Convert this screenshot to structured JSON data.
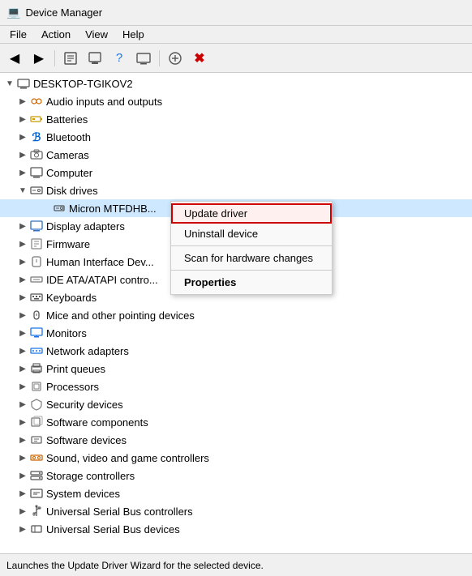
{
  "titleBar": {
    "title": "Device Manager",
    "icon": "💻"
  },
  "menuBar": {
    "items": [
      {
        "id": "file",
        "label": "File"
      },
      {
        "id": "action",
        "label": "Action"
      },
      {
        "id": "view",
        "label": "View"
      },
      {
        "id": "help",
        "label": "Help"
      }
    ]
  },
  "toolbar": {
    "buttons": [
      {
        "id": "back",
        "icon": "◀",
        "label": "Back"
      },
      {
        "id": "forward",
        "icon": "▶",
        "label": "Forward"
      },
      {
        "id": "show-props",
        "icon": "⊟",
        "label": "Properties"
      },
      {
        "id": "update",
        "icon": "📄",
        "label": "Update Driver"
      },
      {
        "id": "uninstall",
        "icon": "❓",
        "label": "Uninstall"
      },
      {
        "id": "scan",
        "icon": "🖥",
        "label": "Scan"
      },
      {
        "id": "add",
        "icon": "➕",
        "label": "Add"
      },
      {
        "id": "remove",
        "icon": "✖",
        "label": "Remove"
      }
    ]
  },
  "tree": {
    "root": "DESKTOP-TGIKOV2",
    "items": [
      {
        "id": "root",
        "label": "DESKTOP-TGIKOV2",
        "indent": 0,
        "expanded": true,
        "icon": "computer",
        "hasExpander": true
      },
      {
        "id": "audio",
        "label": "Audio inputs and outputs",
        "indent": 1,
        "expanded": false,
        "icon": "sound",
        "hasExpander": true
      },
      {
        "id": "batteries",
        "label": "Batteries",
        "indent": 1,
        "expanded": false,
        "icon": "battery",
        "hasExpander": true
      },
      {
        "id": "bluetooth",
        "label": "Bluetooth",
        "indent": 1,
        "expanded": false,
        "icon": "bluetooth",
        "hasExpander": true
      },
      {
        "id": "cameras",
        "label": "Cameras",
        "indent": 1,
        "expanded": false,
        "icon": "camera",
        "hasExpander": true
      },
      {
        "id": "computer",
        "label": "Computer",
        "indent": 1,
        "expanded": false,
        "icon": "computer2",
        "hasExpander": true
      },
      {
        "id": "disk-drives",
        "label": "Disk drives",
        "indent": 1,
        "expanded": true,
        "icon": "disk",
        "hasExpander": true
      },
      {
        "id": "micron",
        "label": "Micron MTFDHB...",
        "indent": 2,
        "expanded": false,
        "icon": "harddisk",
        "hasExpander": false,
        "selected": true
      },
      {
        "id": "display",
        "label": "Display adapters",
        "indent": 1,
        "expanded": false,
        "icon": "adapter",
        "hasExpander": true
      },
      {
        "id": "firmware",
        "label": "Firmware",
        "indent": 1,
        "expanded": false,
        "icon": "firmware",
        "hasExpander": true
      },
      {
        "id": "hid",
        "label": "Human Interface Dev...",
        "indent": 1,
        "expanded": false,
        "icon": "hid",
        "hasExpander": true
      },
      {
        "id": "ide",
        "label": "IDE ATA/ATAPI contro...",
        "indent": 1,
        "expanded": false,
        "icon": "ide",
        "hasExpander": true
      },
      {
        "id": "keyboards",
        "label": "Keyboards",
        "indent": 1,
        "expanded": false,
        "icon": "keyboard",
        "hasExpander": true
      },
      {
        "id": "mice",
        "label": "Mice and other pointing devices",
        "indent": 1,
        "expanded": false,
        "icon": "mouse",
        "hasExpander": true
      },
      {
        "id": "monitors",
        "label": "Monitors",
        "indent": 1,
        "expanded": false,
        "icon": "monitor",
        "hasExpander": true
      },
      {
        "id": "network",
        "label": "Network adapters",
        "indent": 1,
        "expanded": false,
        "icon": "network",
        "hasExpander": true
      },
      {
        "id": "print",
        "label": "Print queues",
        "indent": 1,
        "expanded": false,
        "icon": "print",
        "hasExpander": true
      },
      {
        "id": "proc",
        "label": "Processors",
        "indent": 1,
        "expanded": false,
        "icon": "proc",
        "hasExpander": true
      },
      {
        "id": "security",
        "label": "Security devices",
        "indent": 1,
        "expanded": false,
        "icon": "security",
        "hasExpander": true
      },
      {
        "id": "softcomp",
        "label": "Software components",
        "indent": 1,
        "expanded": false,
        "icon": "softcomp",
        "hasExpander": true
      },
      {
        "id": "softdev",
        "label": "Software devices",
        "indent": 1,
        "expanded": false,
        "icon": "softdev",
        "hasExpander": true
      },
      {
        "id": "sound",
        "label": "Sound, video and game controllers",
        "indent": 1,
        "expanded": false,
        "icon": "sound2",
        "hasExpander": true
      },
      {
        "id": "storage",
        "label": "Storage controllers",
        "indent": 1,
        "expanded": false,
        "icon": "storage",
        "hasExpander": true
      },
      {
        "id": "sysdev",
        "label": "System devices",
        "indent": 1,
        "expanded": false,
        "icon": "sysdev",
        "hasExpander": true
      },
      {
        "id": "usb",
        "label": "Universal Serial Bus controllers",
        "indent": 1,
        "expanded": false,
        "icon": "usb",
        "hasExpander": true
      },
      {
        "id": "usbdev",
        "label": "Universal Serial Bus devices",
        "indent": 1,
        "expanded": false,
        "icon": "usbdev",
        "hasExpander": true
      }
    ]
  },
  "contextMenu": {
    "visible": true,
    "items": [
      {
        "id": "update-driver",
        "label": "Update driver",
        "highlighted": true
      },
      {
        "id": "uninstall-device",
        "label": "Uninstall device",
        "highlighted": false
      },
      {
        "id": "sep1",
        "type": "separator"
      },
      {
        "id": "scan",
        "label": "Scan for hardware changes",
        "highlighted": false
      },
      {
        "id": "sep2",
        "type": "separator"
      },
      {
        "id": "properties",
        "label": "Properties",
        "bold": true,
        "highlighted": false
      }
    ]
  },
  "statusBar": {
    "text": "Launches the Update Driver Wizard for the selected device."
  }
}
